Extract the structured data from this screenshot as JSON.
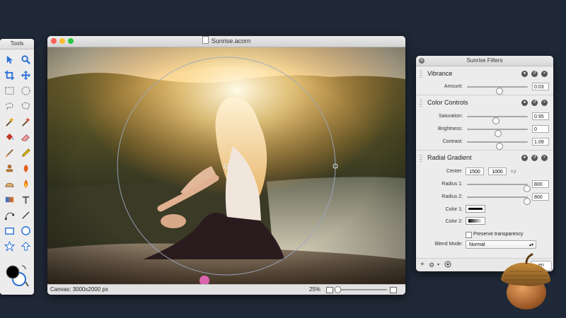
{
  "tools_palette": {
    "title": "Tools",
    "icons": [
      "arrow-select",
      "zoom",
      "crop",
      "move",
      "rect-select",
      "ellipse-select",
      "lasso",
      "poly-lasso",
      "magic-wand",
      "magic-wand-2",
      "paint-bucket",
      "eraser",
      "brush",
      "pencil",
      "clone-stamp",
      "burn",
      "smudge",
      "flame",
      "gradient",
      "text",
      "bezier-pen",
      "line",
      "rectangle",
      "oval",
      "star",
      "arrow-shape"
    ]
  },
  "window": {
    "title": "Sunrise.acorn",
    "canvas_info": "Canvas: 3000x2000 px",
    "zoom": "25%",
    "zoom_fraction": 0.02
  },
  "filters_panel": {
    "title": "Sunrise Filters",
    "vibrance": {
      "name": "Vibrance",
      "amount_label": "Amount:",
      "amount_value": "0.03",
      "amount_pos": 0.52
    },
    "color_controls": {
      "name": "Color Controls",
      "saturation_label": "Saturation:",
      "saturation_value": "0.95",
      "saturation_pos": 0.47,
      "brightness_label": "Brightness:",
      "brightness_value": "0",
      "brightness_pos": 0.5,
      "contrast_label": "Contrast:",
      "contrast_value": "1.09",
      "contrast_pos": 0.52
    },
    "radial_gradient": {
      "name": "Radial Gradient",
      "center_label": "Center:",
      "center_x": "1500",
      "center_y": "1000",
      "center_unit": "x,y",
      "radius1_label": "Radius 1:",
      "radius1_value": "800",
      "radius1_pos": 0.98,
      "radius2_label": "Radius 2:",
      "radius2_value": "800",
      "radius2_pos": 0.98,
      "color1_label": "Color 1:",
      "color2_label": "Color 2:",
      "preserve_label": "Preserve transparency",
      "preserve_checked": false,
      "blend_label": "Blend Mode:",
      "blend_value": "Normal"
    },
    "footer": {
      "add": "+",
      "gear": "⚙",
      "open_fragment": "en"
    }
  },
  "colors": {
    "background": "#1f2836",
    "foreground_color": "#000000",
    "background_color": "#ffffff"
  }
}
